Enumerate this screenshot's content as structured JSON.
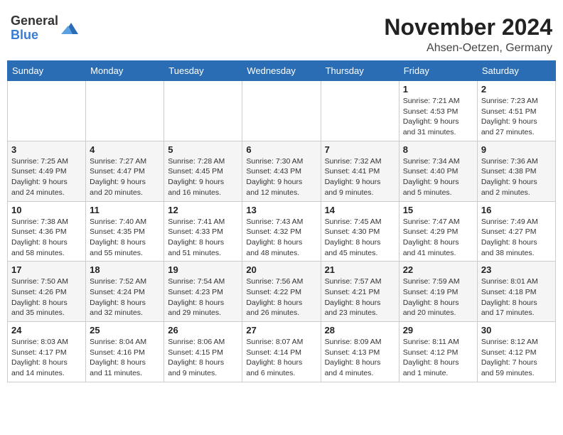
{
  "header": {
    "logo_line1": "General",
    "logo_line2": "Blue",
    "month": "November 2024",
    "location": "Ahsen-Oetzen, Germany"
  },
  "weekdays": [
    "Sunday",
    "Monday",
    "Tuesday",
    "Wednesday",
    "Thursday",
    "Friday",
    "Saturday"
  ],
  "weeks": [
    [
      {
        "day": "",
        "info": ""
      },
      {
        "day": "",
        "info": ""
      },
      {
        "day": "",
        "info": ""
      },
      {
        "day": "",
        "info": ""
      },
      {
        "day": "",
        "info": ""
      },
      {
        "day": "1",
        "info": "Sunrise: 7:21 AM\nSunset: 4:53 PM\nDaylight: 9 hours and 31 minutes."
      },
      {
        "day": "2",
        "info": "Sunrise: 7:23 AM\nSunset: 4:51 PM\nDaylight: 9 hours and 27 minutes."
      }
    ],
    [
      {
        "day": "3",
        "info": "Sunrise: 7:25 AM\nSunset: 4:49 PM\nDaylight: 9 hours and 24 minutes."
      },
      {
        "day": "4",
        "info": "Sunrise: 7:27 AM\nSunset: 4:47 PM\nDaylight: 9 hours and 20 minutes."
      },
      {
        "day": "5",
        "info": "Sunrise: 7:28 AM\nSunset: 4:45 PM\nDaylight: 9 hours and 16 minutes."
      },
      {
        "day": "6",
        "info": "Sunrise: 7:30 AM\nSunset: 4:43 PM\nDaylight: 9 hours and 12 minutes."
      },
      {
        "day": "7",
        "info": "Sunrise: 7:32 AM\nSunset: 4:41 PM\nDaylight: 9 hours and 9 minutes."
      },
      {
        "day": "8",
        "info": "Sunrise: 7:34 AM\nSunset: 4:40 PM\nDaylight: 9 hours and 5 minutes."
      },
      {
        "day": "9",
        "info": "Sunrise: 7:36 AM\nSunset: 4:38 PM\nDaylight: 9 hours and 2 minutes."
      }
    ],
    [
      {
        "day": "10",
        "info": "Sunrise: 7:38 AM\nSunset: 4:36 PM\nDaylight: 8 hours and 58 minutes."
      },
      {
        "day": "11",
        "info": "Sunrise: 7:40 AM\nSunset: 4:35 PM\nDaylight: 8 hours and 55 minutes."
      },
      {
        "day": "12",
        "info": "Sunrise: 7:41 AM\nSunset: 4:33 PM\nDaylight: 8 hours and 51 minutes."
      },
      {
        "day": "13",
        "info": "Sunrise: 7:43 AM\nSunset: 4:32 PM\nDaylight: 8 hours and 48 minutes."
      },
      {
        "day": "14",
        "info": "Sunrise: 7:45 AM\nSunset: 4:30 PM\nDaylight: 8 hours and 45 minutes."
      },
      {
        "day": "15",
        "info": "Sunrise: 7:47 AM\nSunset: 4:29 PM\nDaylight: 8 hours and 41 minutes."
      },
      {
        "day": "16",
        "info": "Sunrise: 7:49 AM\nSunset: 4:27 PM\nDaylight: 8 hours and 38 minutes."
      }
    ],
    [
      {
        "day": "17",
        "info": "Sunrise: 7:50 AM\nSunset: 4:26 PM\nDaylight: 8 hours and 35 minutes."
      },
      {
        "day": "18",
        "info": "Sunrise: 7:52 AM\nSunset: 4:24 PM\nDaylight: 8 hours and 32 minutes."
      },
      {
        "day": "19",
        "info": "Sunrise: 7:54 AM\nSunset: 4:23 PM\nDaylight: 8 hours and 29 minutes."
      },
      {
        "day": "20",
        "info": "Sunrise: 7:56 AM\nSunset: 4:22 PM\nDaylight: 8 hours and 26 minutes."
      },
      {
        "day": "21",
        "info": "Sunrise: 7:57 AM\nSunset: 4:21 PM\nDaylight: 8 hours and 23 minutes."
      },
      {
        "day": "22",
        "info": "Sunrise: 7:59 AM\nSunset: 4:19 PM\nDaylight: 8 hours and 20 minutes."
      },
      {
        "day": "23",
        "info": "Sunrise: 8:01 AM\nSunset: 4:18 PM\nDaylight: 8 hours and 17 minutes."
      }
    ],
    [
      {
        "day": "24",
        "info": "Sunrise: 8:03 AM\nSunset: 4:17 PM\nDaylight: 8 hours and 14 minutes."
      },
      {
        "day": "25",
        "info": "Sunrise: 8:04 AM\nSunset: 4:16 PM\nDaylight: 8 hours and 11 minutes."
      },
      {
        "day": "26",
        "info": "Sunrise: 8:06 AM\nSunset: 4:15 PM\nDaylight: 8 hours and 9 minutes."
      },
      {
        "day": "27",
        "info": "Sunrise: 8:07 AM\nSunset: 4:14 PM\nDaylight: 8 hours and 6 minutes."
      },
      {
        "day": "28",
        "info": "Sunrise: 8:09 AM\nSunset: 4:13 PM\nDaylight: 8 hours and 4 minutes."
      },
      {
        "day": "29",
        "info": "Sunrise: 8:11 AM\nSunset: 4:12 PM\nDaylight: 8 hours and 1 minute."
      },
      {
        "day": "30",
        "info": "Sunrise: 8:12 AM\nSunset: 4:12 PM\nDaylight: 7 hours and 59 minutes."
      }
    ]
  ]
}
